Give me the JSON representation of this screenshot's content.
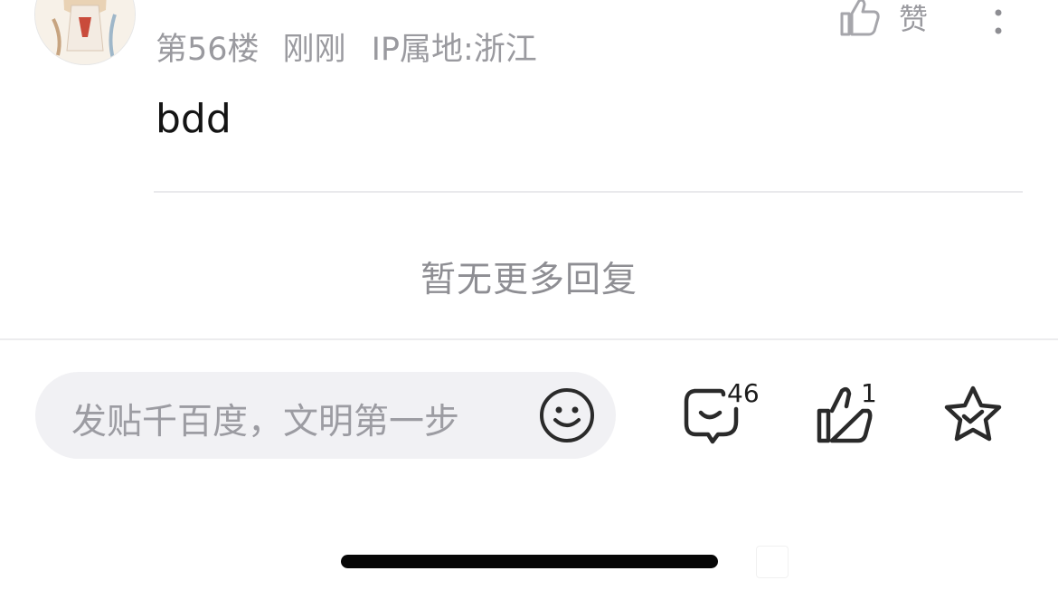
{
  "post": {
    "username": "",
    "floor": "第56楼",
    "time": "刚刚",
    "ip": "IP属地:浙江",
    "like_label": "赞",
    "content": "bdd"
  },
  "replies": {
    "no_more_text": "暂无更多回复"
  },
  "bottom_bar": {
    "input_placeholder": "发贴千百度，文明第一步",
    "comment_count": "46",
    "like_count": "1"
  },
  "icons": {
    "like_top": "thumbs-up-icon",
    "more": "more-vertical-icon",
    "emoji": "smile-icon",
    "comment": "comment-icon",
    "like": "thumbs-up-icon",
    "favorite": "star-icon"
  },
  "colors": {
    "text": "#141414",
    "secondary": "#9a9a9f",
    "input_bg": "#f1f1f4",
    "home_indicator": "#060606"
  }
}
